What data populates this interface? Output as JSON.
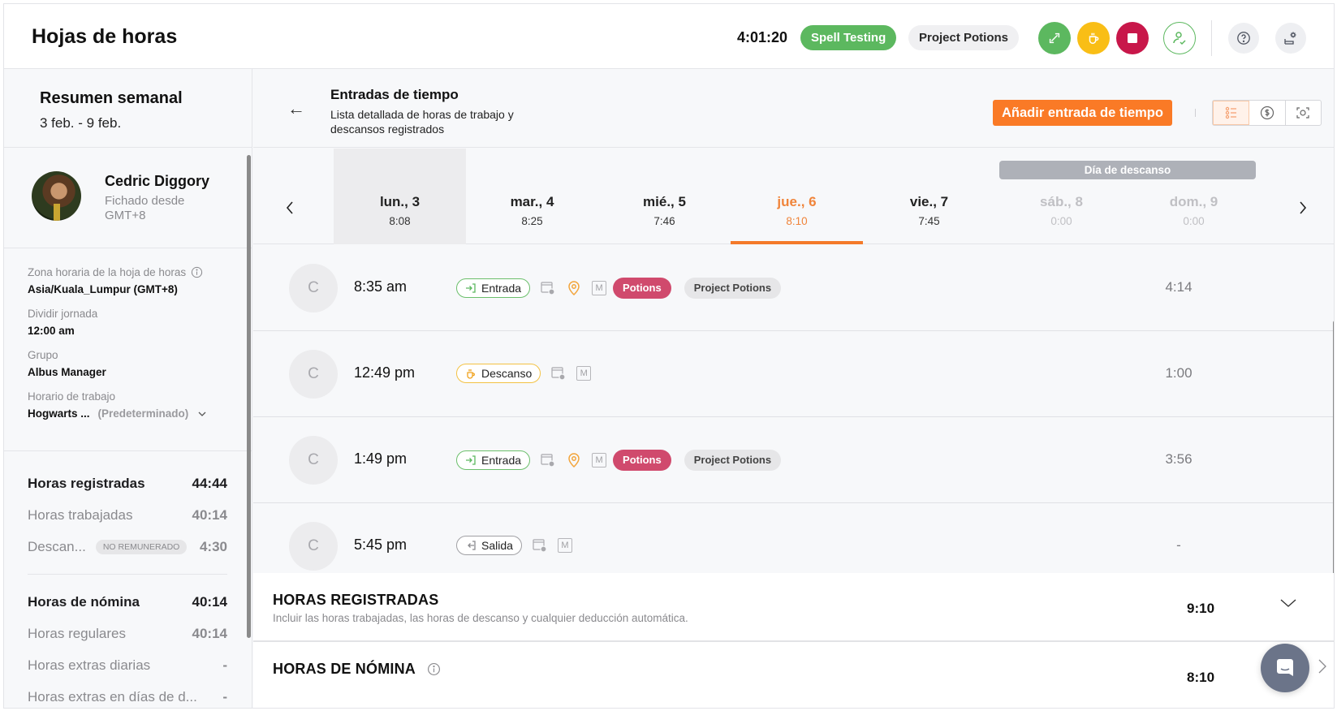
{
  "header": {
    "title": "Hojas de horas",
    "timer": "4:01:20",
    "current_activity": "Spell Testing",
    "current_project": "Project Potions",
    "buttons": {
      "switch": "switch-activity-icon",
      "break": "coffee-icon",
      "stop": "stop-icon",
      "people": "user-check-icon",
      "help": "help-icon",
      "settings": "settings-icon"
    },
    "colors": {
      "switch": "#5cb85f",
      "break": "#f9be16",
      "stop": "#c8174a"
    }
  },
  "sidebar": {
    "week_title": "Resumen semanal",
    "week_range": "3 feb. - 9 feb.",
    "profile": {
      "name": "Cedric Diggory",
      "subtitle": "Fichado desde GMT+8"
    },
    "info": [
      {
        "label": "Zona horaria de la hoja de horas",
        "value": "Asia/Kuala_Lumpur (GMT+8)",
        "has_info_icon": true
      },
      {
        "label": "Dividir jornada",
        "value": "12:00 am"
      },
      {
        "label": "Grupo",
        "value": "Albus Manager"
      },
      {
        "label": "Horario de trabajo",
        "value": "Hogwarts ...",
        "secondary": "(Predeterminado)"
      }
    ],
    "stats_recorded": {
      "title": "Horas registradas",
      "total": "44:44",
      "rows": [
        {
          "label": "Horas trabajadas",
          "value": "40:14"
        },
        {
          "label": "Descan...",
          "badge": "NO REMUNERADO",
          "value": "4:30"
        }
      ]
    },
    "stats_payroll": {
      "title": "Horas de nómina",
      "total": "40:14",
      "rows": [
        {
          "label": "Horas regulares",
          "value": "40:14"
        },
        {
          "label": "Horas extras diarias",
          "value": "-"
        },
        {
          "label": "Horas extras en días de d...",
          "value": "-"
        }
      ]
    }
  },
  "main": {
    "title": "Entradas de tiempo",
    "description": "Lista detallada de horas de trabajo y descansos registrados",
    "add_button": "Añadir entrada de tiempo",
    "view_toggle": [
      "list-icon",
      "dollar-icon",
      "screenshot-icon"
    ],
    "dayoff_banner": "Día de descanso",
    "days": [
      {
        "label": "lun., 3",
        "hours": "8:08",
        "state": "hover"
      },
      {
        "label": "mar., 4",
        "hours": "8:25",
        "state": "normal"
      },
      {
        "label": "mié., 5",
        "hours": "7:46",
        "state": "normal"
      },
      {
        "label": "jue., 6",
        "hours": "8:10",
        "state": "selected"
      },
      {
        "label": "vie., 7",
        "hours": "7:45",
        "state": "normal"
      },
      {
        "label": "sáb., 8",
        "hours": "0:00",
        "state": "off"
      },
      {
        "label": "dom., 9",
        "hours": "0:00",
        "state": "off"
      }
    ],
    "entries": [
      {
        "avatar": "C",
        "time": "8:35 am",
        "type": "Entrada",
        "type_kind": "in",
        "has_location": true,
        "activity": "Potions",
        "project": "Project Potions",
        "duration": "4:14"
      },
      {
        "avatar": "C",
        "time": "12:49 pm",
        "type": "Descanso",
        "type_kind": "break",
        "has_location": false,
        "activity": null,
        "project": null,
        "duration": "1:00"
      },
      {
        "avatar": "C",
        "time": "1:49 pm",
        "type": "Entrada",
        "type_kind": "in",
        "has_location": true,
        "activity": "Potions",
        "project": "Project Potions",
        "duration": "3:56"
      },
      {
        "avatar": "C",
        "time": "5:45 pm",
        "type": "Salida",
        "type_kind": "out",
        "has_location": false,
        "activity": null,
        "project": null,
        "duration": "-"
      }
    ],
    "summary": [
      {
        "title": "HORAS REGISTRADAS",
        "description": "Incluir las horas trabajadas, las horas de descanso y cualquier deducción automática.",
        "value": "9:10"
      },
      {
        "title": "HORAS DE NÓMINA",
        "description": "",
        "value": "8:10",
        "has_info_icon": true
      }
    ],
    "accent_color": "#f47a2a"
  }
}
